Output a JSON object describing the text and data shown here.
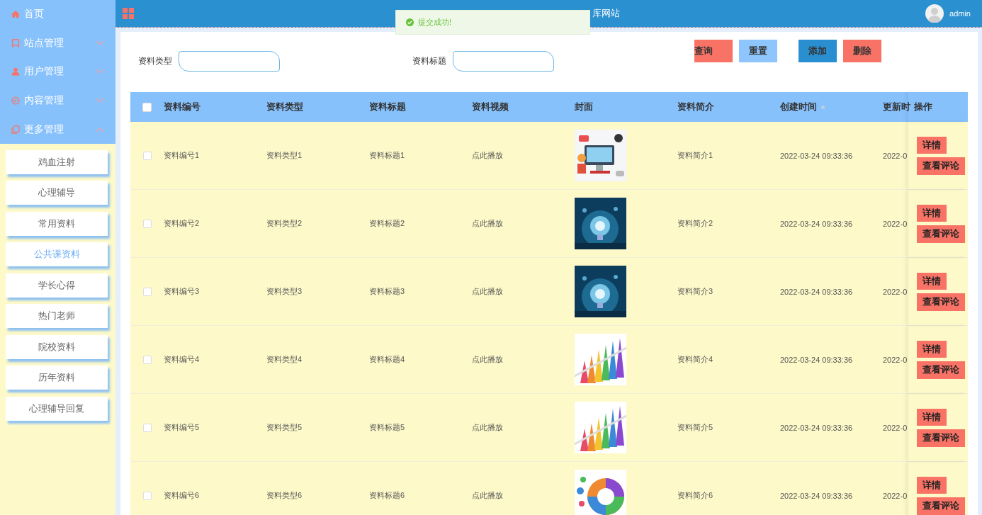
{
  "sidebar": {
    "menus": [
      {
        "label": "首页"
      },
      {
        "label": "站点管理",
        "expanded": false
      },
      {
        "label": "用户管理",
        "expanded": false
      },
      {
        "label": "内容管理",
        "expanded": false
      },
      {
        "label": "更多管理",
        "expanded": true,
        "children": [
          {
            "label": "鸡血注射",
            "selected": false
          },
          {
            "label": "心理辅导",
            "selected": false
          },
          {
            "label": "常用资料",
            "selected": false
          },
          {
            "label": "公共课资料",
            "selected": true
          },
          {
            "label": "学长心得",
            "selected": false
          },
          {
            "label": "热门老师",
            "selected": false
          },
          {
            "label": "院校资料",
            "selected": false
          },
          {
            "label": "历年资料",
            "selected": false
          },
          {
            "label": "心理辅导回复",
            "selected": false
          }
        ]
      }
    ]
  },
  "header": {
    "title": "库网站",
    "user": "admin"
  },
  "toast": {
    "message": "提交成功!"
  },
  "search": {
    "fields": [
      {
        "label": "资料类型"
      },
      {
        "label": "资料标题"
      }
    ],
    "buttons": [
      {
        "label": "查询",
        "kind": "search"
      },
      {
        "label": "重置",
        "kind": "reset"
      },
      {
        "label": "添加",
        "kind": "add"
      },
      {
        "label": "删除",
        "kind": "delete"
      }
    ]
  },
  "table": {
    "select_all": {
      "checked": false
    },
    "columns": [
      "资料编号",
      "资料类型",
      "资料标题",
      "资料视频",
      "封面",
      "资料简介",
      "创建时间",
      "更新时",
      "操作"
    ],
    "rows": [
      {
        "checked": false,
        "number": "资料编号1",
        "type": "资料类型1",
        "title": "资料标题1",
        "video": "点此播放",
        "summary": "资料简介1",
        "created": "2022-03-24 09:33:36",
        "updated": "2022-0",
        "actions": [
          "详情",
          "查看评论"
        ]
      },
      {
        "checked": false,
        "number": "资料编号2",
        "type": "资料类型2",
        "title": "资料标题2",
        "video": "点此播放",
        "summary": "资料简介2",
        "created": "2022-03-24 09:33:36",
        "updated": "2022-0",
        "actions": [
          "详情",
          "查看评论"
        ]
      },
      {
        "checked": false,
        "number": "资料编号3",
        "type": "资料类型3",
        "title": "资料标题3",
        "video": "点此播放",
        "summary": "资料简介3",
        "created": "2022-03-24 09:33:36",
        "updated": "2022-0",
        "actions": [
          "详情",
          "查看评论"
        ]
      },
      {
        "checked": false,
        "number": "资料编号4",
        "type": "资料类型4",
        "title": "资料标题4",
        "video": "点此播放",
        "summary": "资料简介4",
        "created": "2022-03-24 09:33:36",
        "updated": "2022-0",
        "actions": [
          "详情",
          "查看评论"
        ]
      },
      {
        "checked": false,
        "number": "资料编号5",
        "type": "资料类型5",
        "title": "资料标题5",
        "video": "点此播放",
        "summary": "资料简介5",
        "created": "2022-03-24 09:33:36",
        "updated": "2022-0",
        "actions": [
          "详情",
          "查看评论"
        ]
      },
      {
        "checked": false,
        "number": "资料编号6",
        "type": "资料类型6",
        "title": "资料标题6",
        "video": "点此播放",
        "summary": "资料简介6",
        "created": "2022-03-24 09:33:36",
        "updated": "2022-0",
        "actions": [
          "详情",
          "查看评论"
        ]
      }
    ]
  }
}
